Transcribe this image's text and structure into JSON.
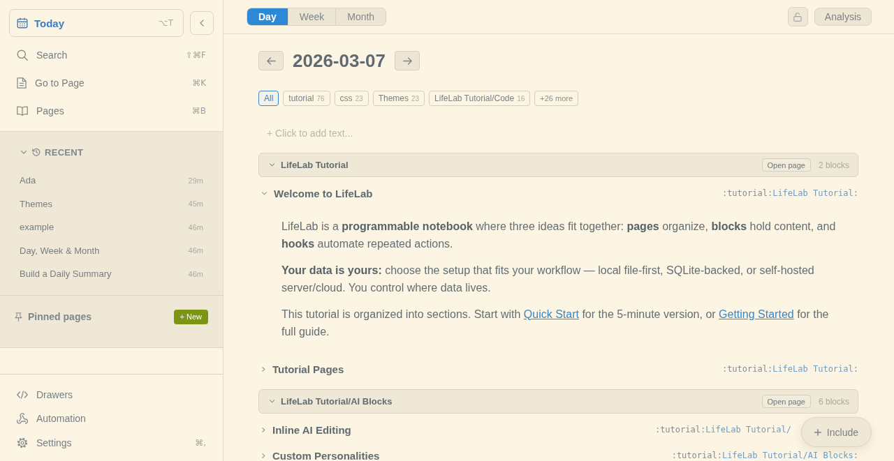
{
  "sidebar": {
    "today": {
      "label": "Today",
      "shortcut": "⌥T"
    },
    "nav_items": [
      {
        "kind": "search",
        "label": "Search",
        "shortcut": "⇧⌘F"
      },
      {
        "kind": "page",
        "label": "Go to Page",
        "shortcut": "⌘K"
      },
      {
        "kind": "book",
        "label": "Pages",
        "shortcut": "⌘B"
      }
    ],
    "recent": {
      "title": "RECENT",
      "expanded": true,
      "items": [
        {
          "label": "Ada",
          "time": "29m"
        },
        {
          "label": "Themes",
          "time": "45m"
        },
        {
          "label": "example",
          "time": "46m"
        },
        {
          "label": "Day, Week & Month",
          "time": "46m"
        },
        {
          "label": "Build a Daily Summary",
          "time": "46m"
        }
      ]
    },
    "pinned": {
      "title": "Pinned pages",
      "new_button": "+ New"
    },
    "footer_items": [
      {
        "kind": "code",
        "label": "Drawers"
      },
      {
        "kind": "webhook",
        "label": "Automation"
      },
      {
        "kind": "settings",
        "label": "Settings",
        "shortcut": "⌘,"
      }
    ]
  },
  "toolbar": {
    "views": [
      {
        "label": "Day",
        "selected": true
      },
      {
        "label": "Week",
        "selected": false
      },
      {
        "label": "Month",
        "selected": false
      }
    ],
    "locked": false,
    "analysis_button": "Analysis"
  },
  "day_view": {
    "date": "2026-03-07",
    "tags": [
      {
        "label": "All",
        "selected": true
      },
      {
        "label": "tutorial",
        "count": "76",
        "selected": false
      },
      {
        "label": "css",
        "count": "23",
        "selected": false
      },
      {
        "label": "Themes",
        "count": "23",
        "selected": false
      },
      {
        "label": "LifeLab Tutorial/Code",
        "count": "16",
        "selected": false
      }
    ],
    "more_tags": "+26 more",
    "add_text": {
      "placeholder": "+ Click to add text..."
    },
    "groups": [
      {
        "title": "LifeLab Tutorial",
        "expanded": true,
        "open_button": "Open page",
        "count": "2 blocks",
        "blocks": [
          {
            "title": "Welcome to LifeLab",
            "expanded": true,
            "meta": {
              "tag": ":tutorial:",
              "page": "LifeLab Tutorial",
              "end": ":"
            },
            "paragraphs": [
              [
                {
                  "kind": "text",
                  "text": "LifeLab is a **programmable notebook** where three ideas fit together: **pages** organize, **blocks** hold content, and **hooks** automate repeated actions."
                }
              ],
              [
                {
                  "kind": "text",
                  "text": "**Your data is yours:** choose the setup that fits your workflow — local file-first, SQLite-backed, or self-hosted server/cloud. You control where data lives."
                }
              ],
              [
                {
                  "kind": "text",
                  "text": "This tutorial is organized into sections. Start with "
                },
                {
                  "kind": "link",
                  "text": "Quick Start"
                },
                {
                  "kind": "text",
                  "text": " for the 5-minute version, or "
                },
                {
                  "kind": "link",
                  "text": "Getting Started"
                },
                {
                  "kind": "text",
                  "text": " for the full guide."
                }
              ]
            ]
          },
          {
            "title": "Tutorial Pages",
            "expanded": false,
            "meta": {
              "tag": ":tutorial:",
              "page": "LifeLab Tutorial",
              "end": ":"
            }
          }
        ]
      },
      {
        "title": "LifeLab Tutorial/AI Blocks",
        "expanded": true,
        "open_button": "Open page",
        "count": "6 blocks",
        "blocks": [
          {
            "title": "Inline AI Editing",
            "expanded": false,
            "meta": {
              "tag": ":tutorial:",
              "page": "LifeLab Tutorial/",
              "partly_hidden": true
            }
          },
          {
            "title": "Custom Personalities",
            "expanded": false,
            "meta": {
              "tag": ":tutorial:",
              "page": "LifeLab Tutorial/AI Blocks",
              "end": ":"
            }
          }
        ]
      }
    ]
  },
  "include_button": "Include"
}
